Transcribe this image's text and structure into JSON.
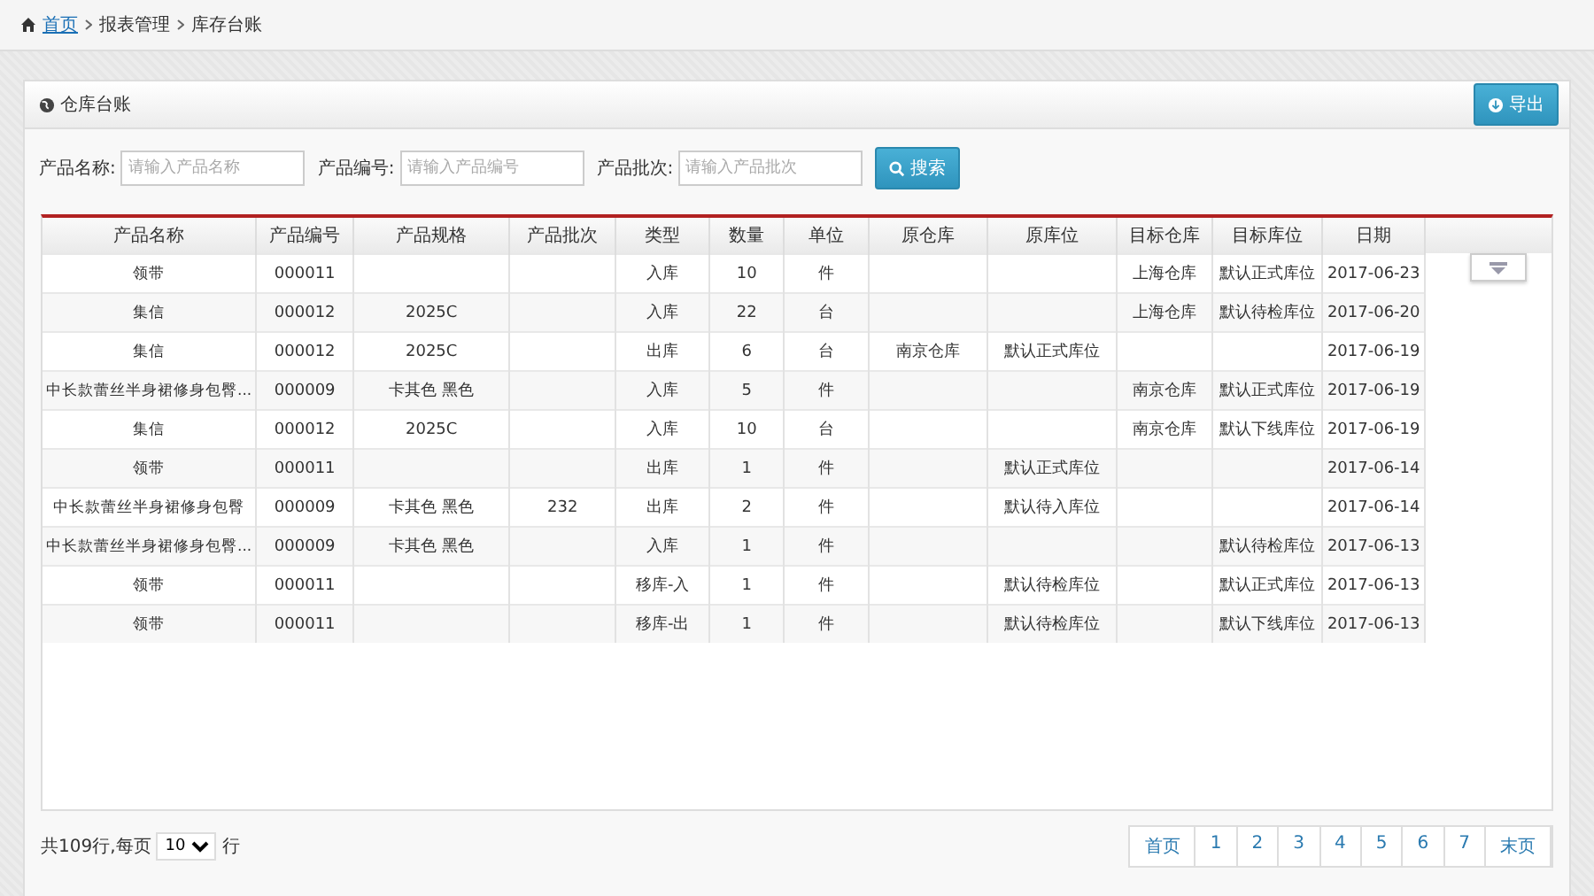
{
  "breadcrumb": [
    {
      "label": "首页",
      "kind": "link"
    },
    {
      "label": "报表管理",
      "kind": "text"
    },
    {
      "label": "库存台账",
      "kind": "text"
    }
  ],
  "panel": {
    "title": "仓库台账",
    "export_button": "导出"
  },
  "filters": [
    {
      "label": "产品名称:",
      "placeholder": "请输入产品名称"
    },
    {
      "label": "产品编号:",
      "placeholder": "请输入产品编号"
    },
    {
      "label": "产品批次:",
      "placeholder": "请输入产品批次"
    }
  ],
  "search_button": "搜索",
  "table": {
    "columns": [
      "产品名称",
      "产品编号",
      "产品规格",
      "产品批次",
      "类型",
      "数量",
      "单位",
      "原仓库",
      "原库位",
      "目标仓库",
      "目标库位",
      "日期"
    ],
    "rows": [
      [
        "领带",
        "000011",
        null,
        null,
        "入库",
        "10",
        "件",
        null,
        null,
        "上海仓库",
        "默认正式库位",
        "2017-06-23"
      ],
      [
        "集信",
        "000012",
        "2025C",
        null,
        "入库",
        "22",
        "台",
        null,
        null,
        "上海仓库",
        "默认待检库位",
        "2017-06-20"
      ],
      [
        "集信",
        "000012",
        "2025C",
        null,
        "出库",
        "6",
        "台",
        "南京仓库",
        "默认正式库位",
        null,
        null,
        "2017-06-19"
      ],
      [
        "中长款蕾丝半身裙修身包臀...",
        "000009",
        "卡其色 黑色",
        null,
        "入库",
        "5",
        "件",
        null,
        null,
        "南京仓库",
        "默认正式库位",
        "2017-06-19"
      ],
      [
        "集信",
        "000012",
        "2025C",
        null,
        "入库",
        "10",
        "台",
        null,
        null,
        "南京仓库",
        "默认下线库位",
        "2017-06-19"
      ],
      [
        "领带",
        "000011",
        null,
        null,
        "出库",
        "1",
        "件",
        null,
        "默认正式库位",
        null,
        null,
        "2017-06-14"
      ],
      [
        "中长款蕾丝半身裙修身包臀",
        "000009",
        "卡其色 黑色",
        "232",
        "出库",
        "2",
        "件",
        null,
        "默认待入库位",
        null,
        null,
        "2017-06-14"
      ],
      [
        "中长款蕾丝半身裙修身包臀...",
        "000009",
        "卡其色 黑色",
        null,
        "入库",
        "1",
        "件",
        null,
        null,
        null,
        "默认待检库位",
        "2017-06-13"
      ],
      [
        "领带",
        "000011",
        null,
        null,
        "移库-入",
        "1",
        "件",
        null,
        "默认待检库位",
        null,
        "默认正式库位",
        "2017-06-13"
      ],
      [
        "领带",
        "000011",
        null,
        null,
        "移库-出",
        "1",
        "件",
        null,
        "默认待检库位",
        null,
        "默认下线库位",
        "2017-06-13"
      ]
    ]
  },
  "footer": {
    "total": "共109行,每页",
    "page_size": "10",
    "suffix": "行"
  },
  "pagination": [
    "首页",
    "1",
    "2",
    "3",
    "4",
    "5",
    "6",
    "7",
    "末页"
  ]
}
